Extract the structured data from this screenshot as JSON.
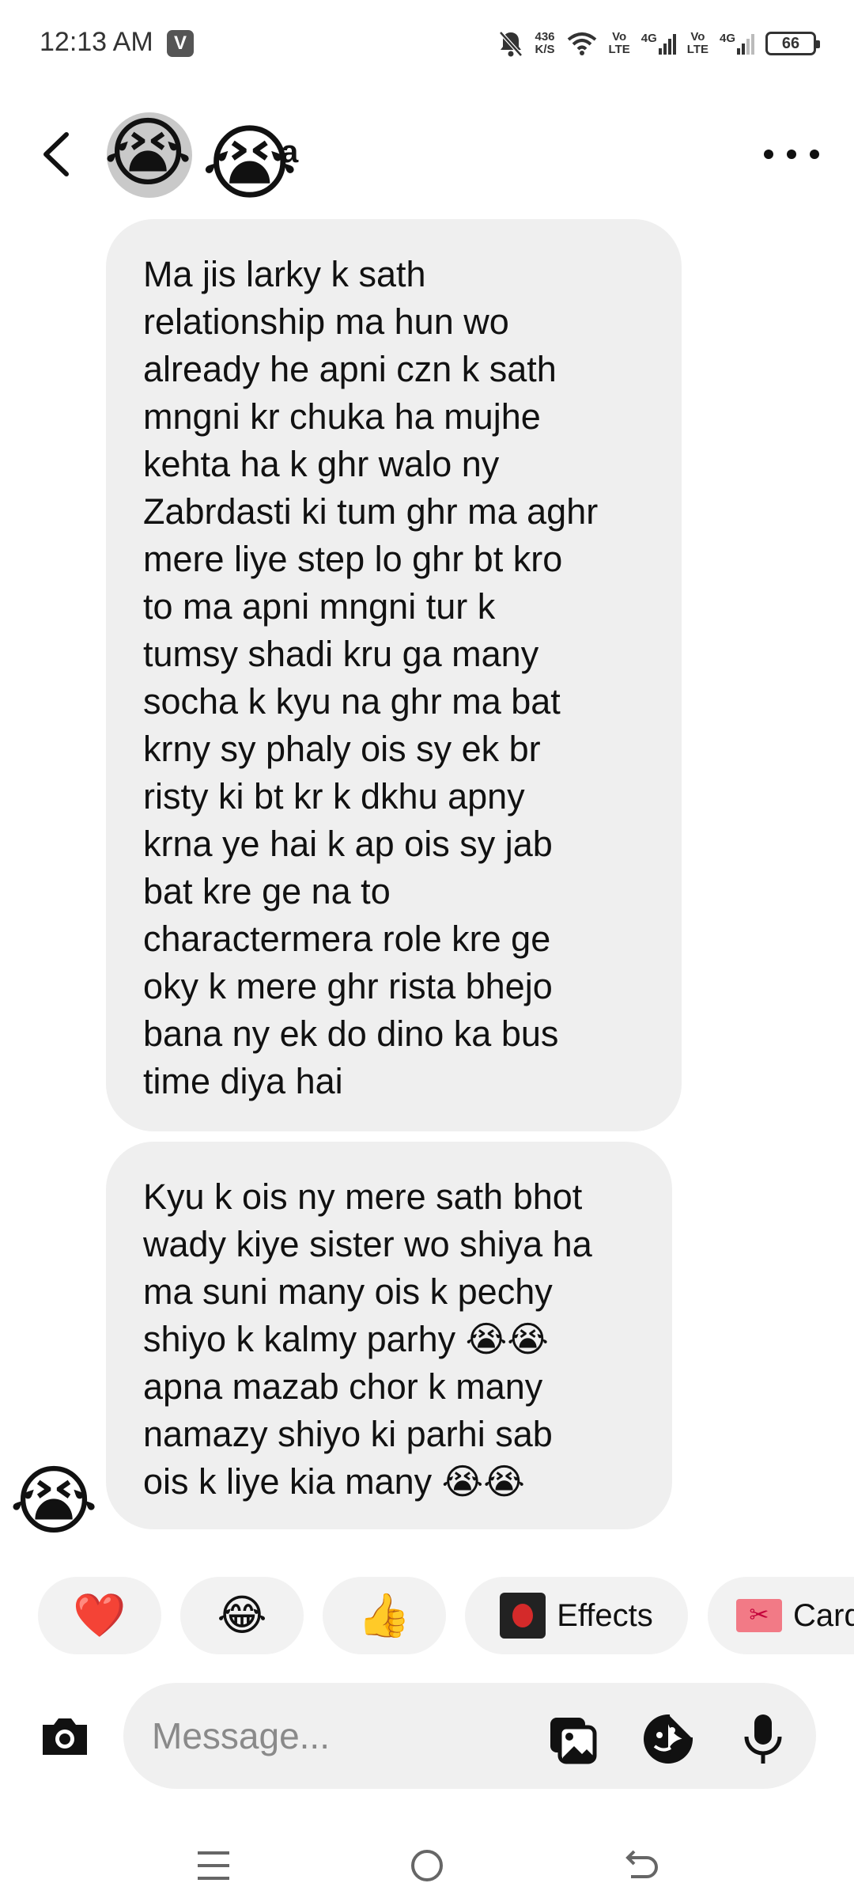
{
  "status_bar": {
    "time": "12:13 AM",
    "app_badge": "V",
    "network_speed_top": "436",
    "network_speed_bottom": "K/S",
    "sim1_label_top": "Vo",
    "sim1_label_bottom": "LTE",
    "sim1_network": "4G",
    "sim2_label_top": "Vo",
    "sim2_label_bottom": "LTE",
    "sim2_network": "4G",
    "battery": "66"
  },
  "header": {
    "contact_name_fragment": "a",
    "avatar_emoji": "😭",
    "overlay_emoji": "😭"
  },
  "messages": [
    {
      "text": "Ma jis larky k sath\nrelationship ma hun wo\nalready he apni czn k sath\nmngni kr chuka ha mujhe\nkehta ha k ghr walo ny\nZabrdasti ki tum ghr ma aghr\nmere liye step lo ghr bt kro\nto ma apni mngni tur k\ntumsy shadi kru ga many\nsocha k kyu na ghr ma bat\nkrny sy phaly ois sy ek br\nristy ki bt kr k dkhu apny\nkrna ye hai k ap ois sy jab\nbat kre ge na to\ncharactermera role kre ge\noky k mere ghr rista bhejo\nbana ny ek do dino ka bus\ntime diya hai"
    },
    {
      "text": "Kyu k ois ny mere sath bhot\nwady kiye sister wo shiya ha\nma suni many ois k pechy\nshiyo k kalmy parhy 😭😭\napna mazab chor k many\nnamazy shiyo ki parhi sab\nois k liye kia many 😭😭"
    }
  ],
  "sender_avatar_emoji": "😭",
  "quick_reactions": {
    "heart": "❤️",
    "laugh": "😂",
    "thumbs_up": "👍",
    "effects_label": "Effects",
    "cards_label": "Cards"
  },
  "composer": {
    "placeholder": "Message..."
  }
}
